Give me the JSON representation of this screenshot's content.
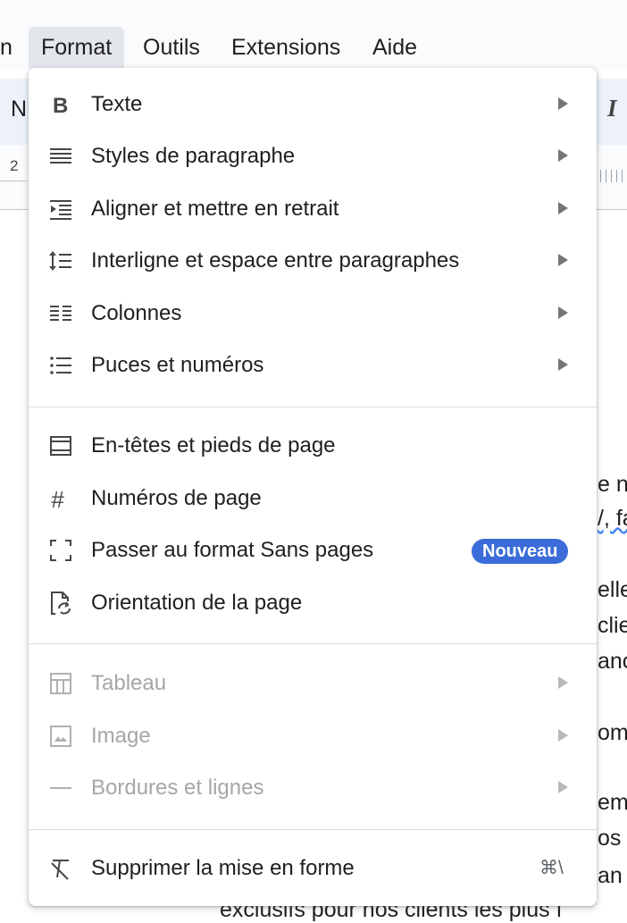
{
  "menubar": {
    "items": [
      "n",
      "Format",
      "Outils",
      "Extensions",
      "Aide"
    ]
  },
  "toolbar": {
    "left_text": "N",
    "right_text": "I"
  },
  "ruler": {
    "number": "2"
  },
  "document": {
    "fragments": [
      "e n",
      "/, fa",
      "elle",
      "clie",
      "anc",
      "om",
      "em",
      "os",
      "an",
      "exclusifs pour nos clients les plus f"
    ]
  },
  "format_menu": {
    "group1": [
      {
        "label": "Texte",
        "icon": "bold-icon"
      },
      {
        "label": "Styles de paragraphe",
        "icon": "paragraph-styles-icon"
      },
      {
        "label": "Aligner et mettre en retrait",
        "icon": "indent-icon"
      },
      {
        "label": "Interligne et espace entre paragraphes",
        "icon": "line-spacing-icon"
      },
      {
        "label": "Colonnes",
        "icon": "columns-icon"
      },
      {
        "label": "Puces et numéros",
        "icon": "bulleted-list-icon"
      }
    ],
    "group2": [
      {
        "label": "En-têtes et pieds de page",
        "icon": "header-footer-icon"
      },
      {
        "label": "Numéros de page",
        "icon": "hash-icon"
      },
      {
        "label": "Passer au format Sans pages",
        "icon": "pageless-icon",
        "badge": "Nouveau"
      },
      {
        "label": "Orientation de la page",
        "icon": "page-orientation-icon"
      }
    ],
    "group3": [
      {
        "label": "Tableau",
        "icon": "table-icon",
        "disabled": true
      },
      {
        "label": "Image",
        "icon": "image-icon",
        "disabled": true
      },
      {
        "label": "Bordures et lignes",
        "icon": "border-line-icon",
        "disabled": true
      }
    ],
    "group4": [
      {
        "label": "Supprimer la mise en forme",
        "icon": "clear-formatting-icon",
        "shortcut": "⌘\\"
      }
    ]
  },
  "colors": {
    "accent_badge": "#3b6cd9",
    "menubar_active": "#e3e6eb",
    "disabled_text": "#a6a6a6"
  }
}
